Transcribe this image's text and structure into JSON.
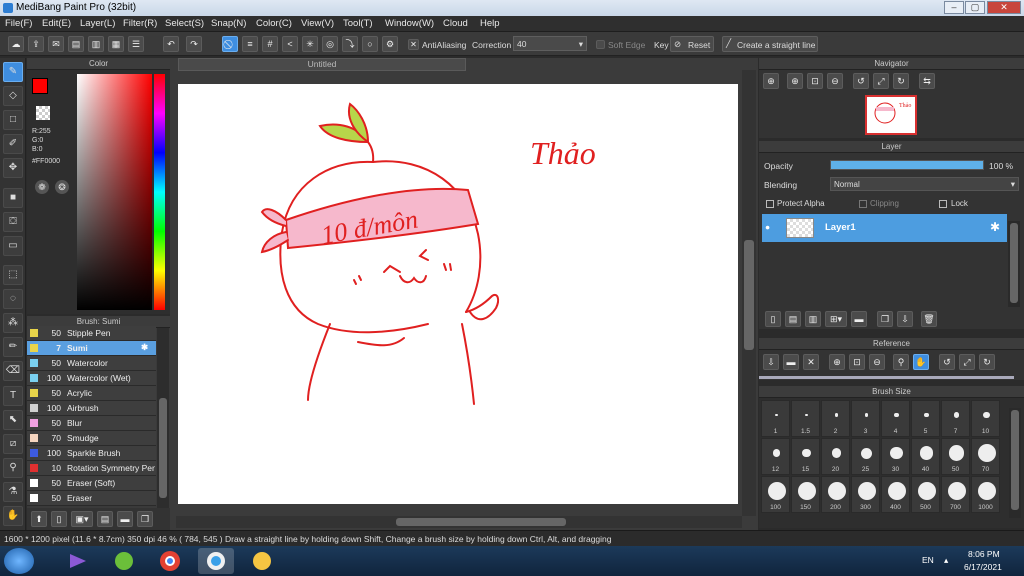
{
  "app": {
    "title": "MediBang Paint Pro (32bit)",
    "window_min": "–",
    "window_max": "▢",
    "window_close": "✕"
  },
  "menu": [
    "File(F)",
    "Edit(E)",
    "Layer(L)",
    "Filter(R)",
    "Select(S)",
    "Snap(N)",
    "Color(C)",
    "View(V)",
    "Tool(T)",
    "Window(W)",
    "Cloud",
    "Help"
  ],
  "toolbar": {
    "antialias_label": "AntiAliasing",
    "correction_label": "Correction",
    "correction_value": "40",
    "soft_edge_label": "Soft Edge",
    "key_label": "Key",
    "reset_label": "Reset",
    "straight_line_label": "Create a straight line"
  },
  "color_panel": {
    "title": "Color",
    "r": "R:255",
    "g": "G:0",
    "b": "B:0",
    "hex": "#FF0000",
    "primary_color": "#ff0000"
  },
  "brush_panel": {
    "title": "Brush: Sumi",
    "items": [
      {
        "size": "50",
        "name": "Stipple Pen",
        "color": "#e8d44a"
      },
      {
        "size": "7",
        "name": "Sumi",
        "color": "#e8d44a"
      },
      {
        "size": "50",
        "name": "Watercolor",
        "color": "#7ad0f0"
      },
      {
        "size": "100",
        "name": "Watercolor (Wet)",
        "color": "#7ad0f0"
      },
      {
        "size": "50",
        "name": "Acrylic",
        "color": "#e8d44a"
      },
      {
        "size": "100",
        "name": "Airbrush",
        "color": "#cfcfcf"
      },
      {
        "size": "50",
        "name": "Blur",
        "color": "#f0a0e0"
      },
      {
        "size": "70",
        "name": "Smudge",
        "color": "#f5d5c0"
      },
      {
        "size": "100",
        "name": "Sparkle Brush",
        "color": "#3d5be0"
      },
      {
        "size": "10",
        "name": "Rotation Symmetry Pen",
        "color": "#e03030"
      },
      {
        "size": "50",
        "name": "Eraser (Soft)",
        "color": "#ffffff"
      },
      {
        "size": "50",
        "name": "Eraser",
        "color": "#ffffff"
      }
    ]
  },
  "canvas": {
    "tab_title": "Untitled",
    "handwriting": "Thảo",
    "headband_text": "10 đ/môn"
  },
  "navigator": {
    "title": "Navigator"
  },
  "layer_panel": {
    "title": "Layer",
    "opacity_label": "Opacity",
    "opacity_value": "100 %",
    "opacity_fraction": 1.0,
    "blending_label": "Blending",
    "blending_value": "Normal",
    "protect_alpha": "Protect Alpha",
    "clipping": "Clipping",
    "lock": "Lock",
    "layer_name": "Layer1"
  },
  "reference": {
    "title": "Reference"
  },
  "brush_size": {
    "title": "Brush Size",
    "sizes": [
      "1",
      "1.5",
      "2",
      "3",
      "4",
      "5",
      "7",
      "10",
      "12",
      "15",
      "20",
      "25",
      "30",
      "40",
      "50",
      "70",
      "100",
      "150",
      "200",
      "300",
      "400",
      "500",
      "700",
      "1000"
    ]
  },
  "status": {
    "text": "1600 * 1200 pixel   (11.6 * 8.7cm)   350 dpi   46 %   ( 784, 545 )   Draw a straight line by holding down Shift, Change a brush size by holding down Ctrl, Alt, and dragging"
  },
  "taskbar": {
    "lang": "EN",
    "time": "8:06 PM",
    "date": "6/17/2021"
  }
}
